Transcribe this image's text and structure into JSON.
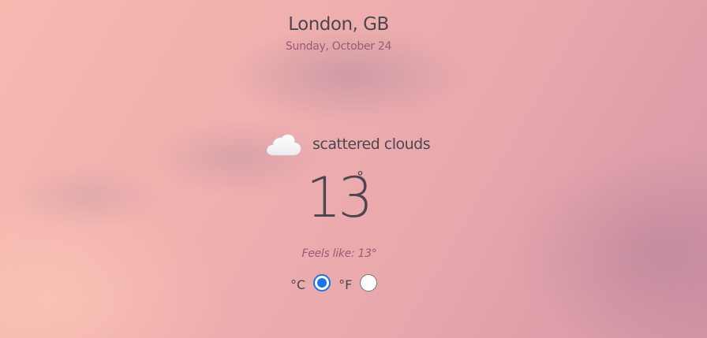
{
  "header": {
    "location": "London, GB",
    "date": "Sunday, October 24"
  },
  "weather": {
    "icon": "cloud-icon",
    "condition": "scattered clouds",
    "temperature": "13",
    "degree_symbol": "°",
    "feels_like": "Feels like: 13°"
  },
  "units": {
    "celsius_label": "°C",
    "fahrenheit_label": "°F",
    "selected": "celsius",
    "accent_color": "#1a73e8"
  }
}
